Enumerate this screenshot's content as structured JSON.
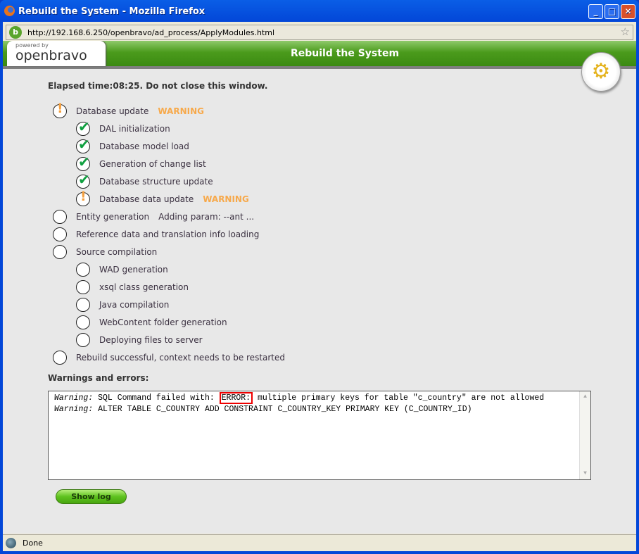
{
  "window": {
    "title": "Rebuild the System - Mozilla Firefox",
    "url": "http://192.168.6.250/openbravo/ad_process/ApplyModules.html",
    "status": "Done"
  },
  "header": {
    "logo_small": "powered by",
    "logo": "openbravo",
    "title": "Rebuild the System"
  },
  "elapsed": "Elapsed time:08:25. Do not close this window.",
  "steps": [
    {
      "label": "Database update",
      "state": "warning",
      "badge": "WARNING"
    },
    {
      "label": "DAL initialization",
      "state": "done"
    },
    {
      "label": "Database model load",
      "state": "done"
    },
    {
      "label": "Generation of change list",
      "state": "done"
    },
    {
      "label": "Database structure update",
      "state": "done"
    },
    {
      "label": "Database data update",
      "state": "warning",
      "badge": "WARNING"
    },
    {
      "label": "Entity generation",
      "state": "running",
      "extra": "Adding param: --ant ..."
    },
    {
      "label": "Reference data and translation info loading",
      "state": "pending"
    },
    {
      "label": "Source compilation",
      "state": "pending"
    },
    {
      "label": "WAD generation",
      "state": "pending"
    },
    {
      "label": "xsql class generation",
      "state": "pending"
    },
    {
      "label": "Java compilation",
      "state": "pending"
    },
    {
      "label": "WebContent folder generation",
      "state": "pending"
    },
    {
      "label": "Deploying files to server",
      "state": "pending"
    },
    {
      "label": "Rebuild successful, context needs to be restarted",
      "state": "pending"
    }
  ],
  "warnings": {
    "label": "Warnings and errors:",
    "lines": [
      {
        "prefix": "Warning:",
        "pre": " SQL Command failed with: ",
        "error": "ERROR:",
        "post": " multiple primary keys for table \"c_country\" are not allowed"
      },
      {
        "prefix": "Warning:",
        "pre": " ALTER TABLE C_COUNTRY ADD CONSTRAINT C_COUNTRY_KEY PRIMARY KEY (C_COUNTRY_ID)"
      }
    ]
  },
  "show_log": "Show log"
}
